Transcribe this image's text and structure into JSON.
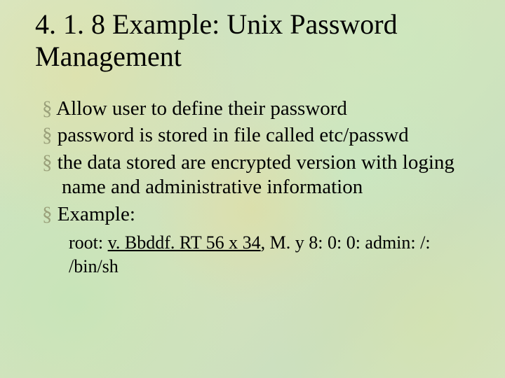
{
  "title": "4. 1. 8 Example: Unix Password Management",
  "bullets": [
    "Allow user to define their password",
    "password is stored in file called etc/passwd",
    "the data stored are encrypted version with loging name and administrative information",
    "Example:"
  ],
  "example_plain1": "root: ",
  "example_underline": "v. Bbddf. RT 56 x 34",
  "example_plain2": ", M. y 8: 0: 0: admin: /: /bin/sh"
}
